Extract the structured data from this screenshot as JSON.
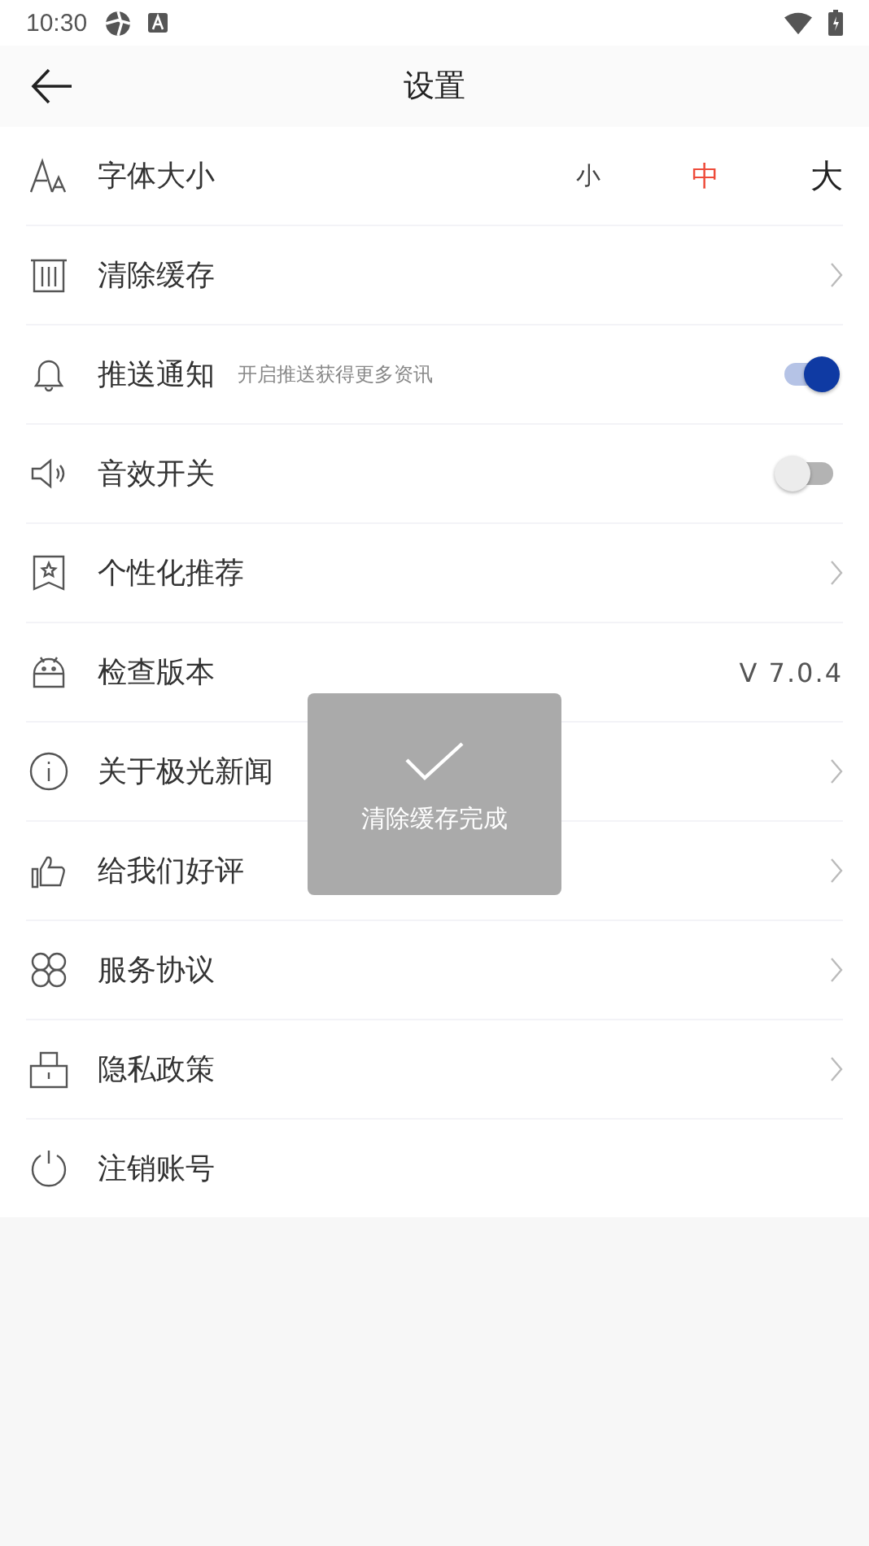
{
  "status_bar": {
    "time": "10:30"
  },
  "header": {
    "title": "设置"
  },
  "rows": [
    {
      "kind": "font_size",
      "label": "字体大小",
      "options": [
        {
          "label": "小",
          "selected": false
        },
        {
          "label": "中",
          "selected": true
        },
        {
          "label": "大",
          "selected": false
        }
      ]
    },
    {
      "kind": "link",
      "label": "清除缓存"
    },
    {
      "kind": "toggle",
      "label": "推送通知",
      "hint": "开启推送获得更多资讯",
      "on": true
    },
    {
      "kind": "toggle",
      "label": "音效开关",
      "on": false
    },
    {
      "kind": "link",
      "label": "个性化推荐"
    },
    {
      "kind": "value",
      "label": "检查版本",
      "value": "V 7.0.4"
    },
    {
      "kind": "link",
      "label": "关于极光新闻"
    },
    {
      "kind": "link",
      "label": "给我们好评"
    },
    {
      "kind": "link",
      "label": "服务协议"
    },
    {
      "kind": "link",
      "label": "隐私政策"
    },
    {
      "kind": "plain",
      "label": "注销账号"
    }
  ],
  "toast": {
    "message": "清除缓存完成"
  }
}
